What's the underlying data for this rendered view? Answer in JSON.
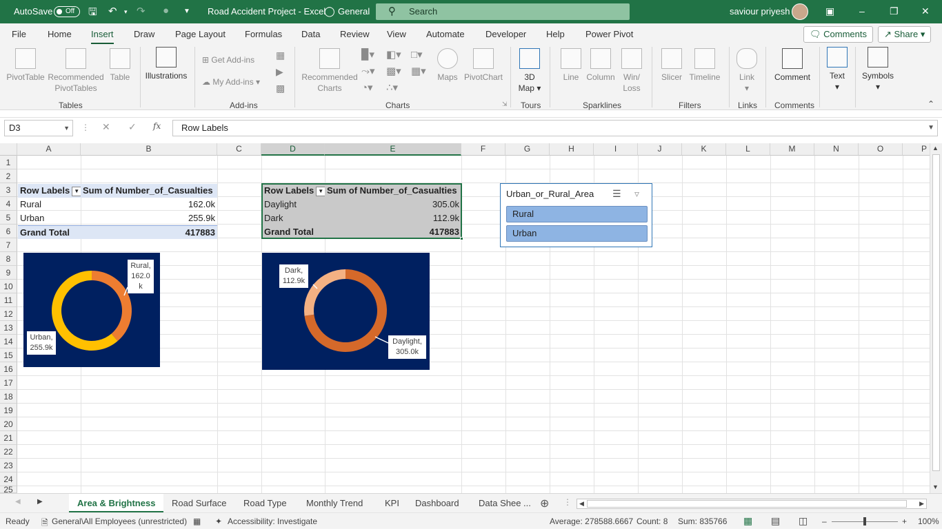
{
  "titlebar": {
    "autosave_label": "AutoSave",
    "autosave_state": "Off",
    "title": "Road Accident Project  -  Excel",
    "sensitivity": "General",
    "search_placeholder": "Search",
    "user": "saviour priyesh"
  },
  "menu": {
    "tabs": [
      "File",
      "Home",
      "Insert",
      "Draw",
      "Page Layout",
      "Formulas",
      "Data",
      "Review",
      "View",
      "Automate",
      "Developer",
      "Help",
      "Power Pivot"
    ],
    "active_tab": "Insert",
    "comments_label": "Comments",
    "share_label": "Share"
  },
  "ribbon": {
    "pivottable": "PivotTable",
    "recommended_pivottables_1": "Recommended",
    "recommended_pivottables_2": "PivotTables",
    "table": "Table",
    "illustrations": "Illustrations",
    "get_addins": "Get Add-ins",
    "my_addins": "My Add-ins",
    "recommended_charts_1": "Recommended",
    "recommended_charts_2": "Charts",
    "maps": "Maps",
    "pivotchart": "PivotChart",
    "map3d_1": "3D",
    "map3d_2": "Map",
    "line": "Line",
    "column": "Column",
    "winloss_1": "Win/",
    "winloss_2": "Loss",
    "slicer": "Slicer",
    "timeline": "Timeline",
    "link": "Link",
    "comment": "Comment",
    "text": "Text",
    "symbols": "Symbols",
    "groups": [
      "Tables",
      "Add-ins",
      "Charts",
      "Tours",
      "Sparklines",
      "Filters",
      "Links",
      "Comments"
    ]
  },
  "formula_bar": {
    "name_box": "D3",
    "formula": "Row Labels"
  },
  "columns": [
    "A",
    "B",
    "C",
    "D",
    "E",
    "F",
    "G",
    "H",
    "I",
    "J",
    "K",
    "L",
    "M",
    "N",
    "O",
    "P"
  ],
  "rows": [
    "1",
    "2",
    "3",
    "4",
    "5",
    "6",
    "7",
    "8",
    "9",
    "10",
    "11",
    "12",
    "13",
    "14",
    "15",
    "16",
    "17",
    "18",
    "19",
    "20",
    "21",
    "22",
    "23",
    "24",
    "25"
  ],
  "pivot1": {
    "header_labels": "Row Labels",
    "header_value": "Sum of Number_of_Casualties",
    "rows": [
      {
        "label": "Rural",
        "value": "162.0k"
      },
      {
        "label": "Urban",
        "value": "255.9k"
      }
    ],
    "total_label": "Grand Total",
    "total_value": "417883"
  },
  "pivot2": {
    "header_labels": "Row Labels",
    "header_value": "Sum of Number_of_Casualties",
    "rows": [
      {
        "label": "Daylight",
        "value": "305.0k"
      },
      {
        "label": "Dark",
        "value": "112.9k"
      }
    ],
    "total_label": "Grand Total",
    "total_value": "417883"
  },
  "chart_data": [
    {
      "type": "pie",
      "variant": "doughnut",
      "categories": [
        "Rural",
        "Urban"
      ],
      "values": [
        162.0,
        255.9
      ],
      "colors": [
        "#ed7d31",
        "#ffc000"
      ],
      "labels": [
        "Rural, 162.0 k",
        "Urban, 255.9k"
      ],
      "background": "#002060"
    },
    {
      "type": "pie",
      "variant": "doughnut",
      "categories": [
        "Daylight",
        "Dark"
      ],
      "values": [
        305.0,
        112.9
      ],
      "colors": [
        "#d5692a",
        "#f4b183"
      ],
      "labels": [
        "Daylight, 305.0k",
        "Dark, 112.9k"
      ],
      "background": "#002060"
    }
  ],
  "slicer": {
    "title": "Urban_or_Rural_Area",
    "items": [
      "Rural",
      "Urban"
    ]
  },
  "sheets": {
    "tabs": [
      "Area & Brightness",
      "Road Surface",
      "Road Type",
      "Monthly Trend",
      "KPI",
      "Dashboard",
      "Data Shee ..."
    ],
    "active": "Area & Brightness"
  },
  "status": {
    "ready": "Ready",
    "sensitivity": "General\\All Employees (unrestricted)",
    "accessibility": "Accessibility: Investigate",
    "average": "Average: 278588.6667",
    "count": "Count: 8",
    "sum": "Sum: 835766",
    "zoom": "100%"
  },
  "colors": {
    "accent": "#217346",
    "chart_bg": "#002060",
    "slicer_selected": "#8eb4e3"
  }
}
